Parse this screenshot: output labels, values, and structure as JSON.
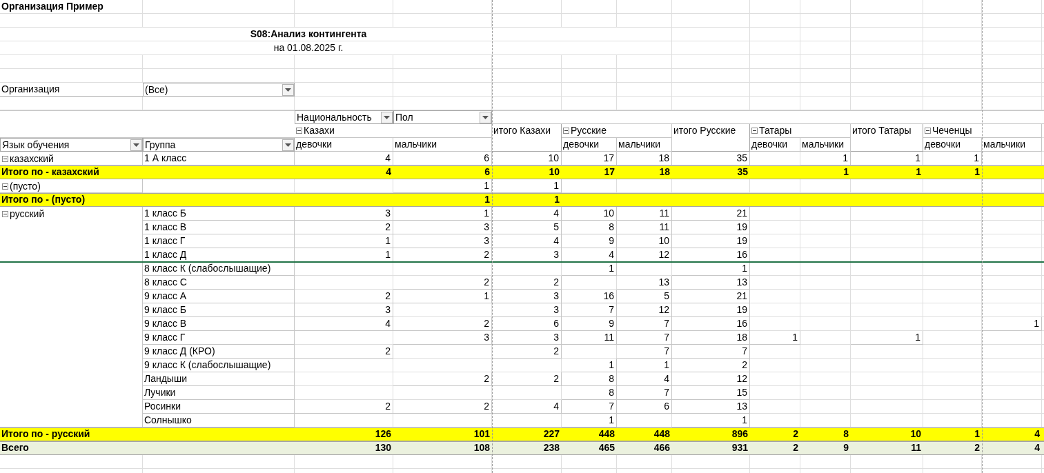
{
  "organization": "Организация Пример",
  "report": {
    "title": "S08:Анализ контингента",
    "date": "на 01.08.2025 г."
  },
  "filter": {
    "label": "Организация",
    "value": "(Все)"
  },
  "column_fields": [
    "Национальность",
    "Пол"
  ],
  "row_fields": [
    "Язык обучения",
    "Группа"
  ],
  "nationalities": [
    {
      "name": "Казахи",
      "expanded": true,
      "genders": [
        "девочки",
        "мальчики"
      ],
      "total": "итого Казахи"
    },
    {
      "name": "Русские",
      "expanded": true,
      "genders": [
        "девочки",
        "мальчики"
      ],
      "total": "итого Русские"
    },
    {
      "name": "Татары",
      "expanded": true,
      "genders": [
        "девочки",
        "мальчики"
      ],
      "total": "итого Татары"
    },
    {
      "name": "Чеченцы",
      "expanded": true,
      "genders": [
        "девочки",
        "мальчики"
      ]
    }
  ],
  "languages": [
    {
      "name": "казахский",
      "expanded": true,
      "groups": [
        {
          "name": "1 А класс",
          "counts": {
            "kazakhs": {
              "girls": "4",
              "boys": "6",
              "total": "10"
            },
            "russians": {
              "girls": "17",
              "boys": "18",
              "total": "35"
            },
            "tatars": {
              "boys": "1",
              "total": "1"
            },
            "chechens": {
              "girls": "1"
            }
          }
        }
      ],
      "subtotal": {
        "label": "Итого по - казахский",
        "counts": {
          "kazakhs": {
            "girls": "4",
            "boys": "6",
            "total": "10"
          },
          "russians": {
            "girls": "17",
            "boys": "18",
            "total": "35"
          },
          "tatars": {
            "boys": "1",
            "total": "1"
          },
          "chechens": {
            "girls": "1"
          }
        }
      }
    },
    {
      "name": "(пусто)",
      "expanded": true,
      "groups": [
        {
          "counts": {
            "kazakhs": {
              "boys": "1",
              "total": "1"
            }
          }
        }
      ],
      "subtotal": {
        "label": "Итого по - (пусто)",
        "counts": {
          "kazakhs": {
            "boys": "1",
            "total": "1"
          }
        }
      }
    },
    {
      "name": "русский",
      "expanded": true,
      "groups": [
        {
          "name": "1 класс Б",
          "counts": {
            "kazakhs": {
              "girls": "3",
              "boys": "1",
              "total": "4"
            },
            "russians": {
              "girls": "10",
              "boys": "11",
              "total": "21"
            }
          }
        },
        {
          "name": "1 класс В",
          "counts": {
            "kazakhs": {
              "girls": "2",
              "boys": "3",
              "total": "5"
            },
            "russians": {
              "girls": "8",
              "boys": "11",
              "total": "19"
            }
          }
        },
        {
          "name": "1 класс Г",
          "counts": {
            "kazakhs": {
              "girls": "1",
              "boys": "3",
              "total": "4"
            },
            "russians": {
              "girls": "9",
              "boys": "10",
              "total": "19"
            }
          }
        },
        {
          "name": "1 класс Д",
          "counts": {
            "kazakhs": {
              "girls": "1",
              "boys": "2",
              "total": "3"
            },
            "russians": {
              "girls": "4",
              "boys": "12",
              "total": "16"
            }
          }
        },
        {
          "name": "8 класс К (слабослышащие)",
          "counts": {
            "russians": {
              "girls": "1",
              "total": "1"
            }
          }
        },
        {
          "name": "8 класс С",
          "counts": {
            "kazakhs": {
              "boys": "2",
              "total": "2"
            },
            "russians": {
              "boys": "13",
              "total": "13"
            }
          }
        },
        {
          "name": "9 класс А",
          "counts": {
            "kazakhs": {
              "girls": "2",
              "boys": "1",
              "total": "3"
            },
            "russians": {
              "girls": "16",
              "boys": "5",
              "total": "21"
            }
          }
        },
        {
          "name": "9 класс Б",
          "counts": {
            "kazakhs": {
              "girls": "3",
              "total": "3"
            },
            "russians": {
              "girls": "7",
              "boys": "12",
              "total": "19"
            }
          }
        },
        {
          "name": "9 класс В",
          "counts": {
            "kazakhs": {
              "girls": "4",
              "boys": "2",
              "total": "6"
            },
            "russians": {
              "girls": "9",
              "boys": "7",
              "total": "16"
            },
            "chechens": {
              "boys": "1"
            }
          }
        },
        {
          "name": "9 класс Г",
          "counts": {
            "kazakhs": {
              "boys": "3",
              "total": "3"
            },
            "russians": {
              "girls": "11",
              "boys": "7",
              "total": "18"
            },
            "tatars": {
              "girls": "1",
              "total": "1"
            }
          }
        },
        {
          "name": "9 класс Д (КРО)",
          "counts": {
            "kazakhs": {
              "girls": "2",
              "total": "2"
            },
            "russians": {
              "boys": "7",
              "total": "7"
            }
          }
        },
        {
          "name": "9 класс К (слабослышащие)",
          "counts": {
            "russians": {
              "girls": "1",
              "boys": "1",
              "total": "2"
            }
          }
        },
        {
          "name": "Ландыши",
          "counts": {
            "kazakhs": {
              "boys": "2",
              "total": "2"
            },
            "russians": {
              "girls": "8",
              "boys": "4",
              "total": "12"
            }
          }
        },
        {
          "name": "Лучики",
          "counts": {
            "russians": {
              "girls": "8",
              "boys": "7",
              "total": "15"
            }
          }
        },
        {
          "name": "Росинки",
          "counts": {
            "kazakhs": {
              "girls": "2",
              "boys": "2",
              "total": "4"
            },
            "russians": {
              "girls": "7",
              "boys": "6",
              "total": "13"
            }
          }
        },
        {
          "name": "Солнышко",
          "counts": {
            "russians": {
              "girls": "1",
              "total": "1"
            }
          }
        }
      ],
      "subtotal": {
        "label": "Итого по - русский",
        "counts": {
          "kazakhs": {
            "girls": "126",
            "boys": "101",
            "total": "227"
          },
          "russians": {
            "girls": "448",
            "boys": "448",
            "total": "896"
          },
          "tatars": {
            "girls": "2",
            "boys": "8",
            "total": "10"
          },
          "chechens": {
            "girls": "1",
            "boys": "4"
          }
        }
      }
    }
  ],
  "total": {
    "label": "Всего",
    "counts": {
      "kazakhs": {
        "girls": "130",
        "boys": "108",
        "total": "238"
      },
      "russians": {
        "girls": "465",
        "boys": "466",
        "total": "931"
      },
      "tatars": {
        "girls": "2",
        "boys": "9",
        "total": "11"
      },
      "chechens": {
        "girls": "2",
        "boys": "4"
      }
    }
  }
}
